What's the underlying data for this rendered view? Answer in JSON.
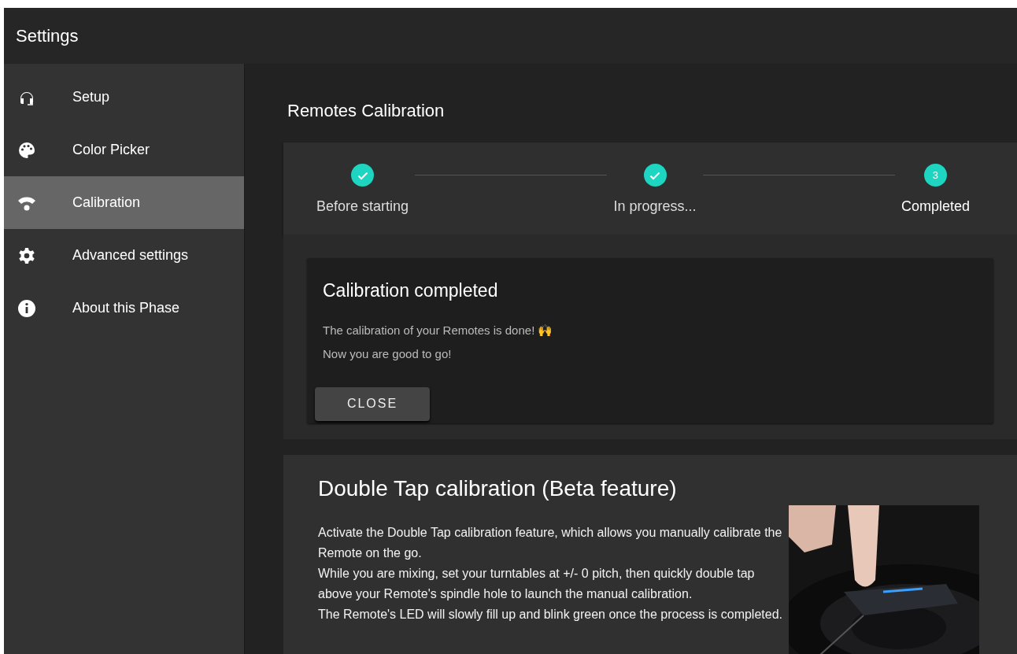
{
  "window": {
    "title": "Settings"
  },
  "sidebar": {
    "items": [
      {
        "label": "Setup",
        "selected": false
      },
      {
        "label": "Color Picker",
        "selected": false
      },
      {
        "label": "Calibration",
        "selected": true
      },
      {
        "label": "Advanced settings",
        "selected": false
      },
      {
        "label": "About this Phase",
        "selected": false
      }
    ]
  },
  "page_title": "Remotes Calibration",
  "stepper": {
    "steps": [
      {
        "label": "Before starting",
        "completed": true,
        "active": false
      },
      {
        "label": "In progress...",
        "completed": true,
        "active": false
      },
      {
        "label": "Completed",
        "number": "3",
        "completed": false,
        "active": true
      }
    ]
  },
  "result_card": {
    "title": "Calibration completed",
    "lines": [
      "The calibration of your Remotes is done! 🙌",
      "Now you are good to go!"
    ],
    "button": "CLOSE"
  },
  "double_tap": {
    "title": "Double Tap calibration (Beta feature)",
    "paragraphs": [
      "Activate the Double Tap calibration feature, which allows you manually calibrate the Remote on the go.",
      "While you are mixing, set your turntables at +/- 0 pitch, then quickly double tap above your Remote's spindle hole to launch the manual calibration.",
      "The Remote's LED will slowly fill up and blink green once the process is completed."
    ]
  }
}
